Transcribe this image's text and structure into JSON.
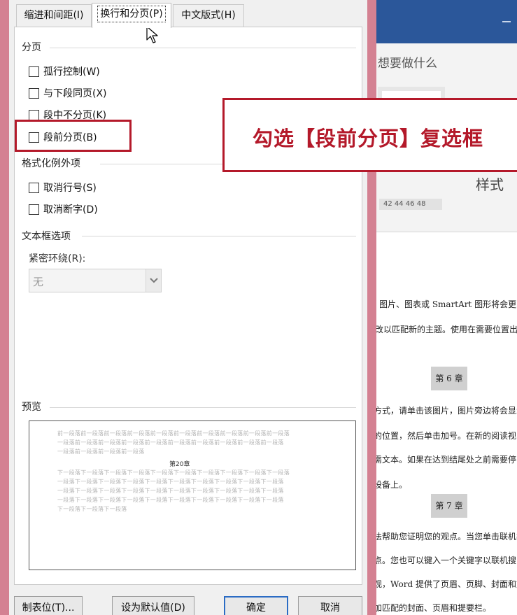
{
  "dialog": {
    "tabs": [
      {
        "label": "缩进和间距(I)"
      },
      {
        "label": "换行和分页(P)",
        "active": true
      },
      {
        "label": "中文版式(H)"
      }
    ],
    "pagination": {
      "title": "分页",
      "widow_control": "孤行控制(W)",
      "keep_with_next": "与下段同页(X)",
      "keep_lines_together": "段中不分页(K)",
      "page_break_before": "段前分页(B)"
    },
    "exceptions": {
      "title": "格式化例外项",
      "suppress_line_numbers": "取消行号(S)",
      "dont_hyphenate": "取消断字(D)"
    },
    "textbox": {
      "title": "文本框选项",
      "wrap_label": "紧密环绕(R):",
      "wrap_value": "无"
    },
    "preview": {
      "title": "预览",
      "prev_lines": [
        "前一段落前一段落前一段落前一段落前一段落前一段落前一段落前一段落前一段落前一段落",
        "一段落前一段落前一段落前一段落前一段落前一段落前一段落前一段落前一段落前一段落",
        "一段落前一段落前一段落前一段落"
      ],
      "heading": "第20章",
      "next_lines": [
        "下一段落下一段落下一段落下一段落下一段落下一段落下一段落下一段落下一段落下一段落",
        "一段落下一段落下一段落下一段落下一段落下一段落下一段落下一段落下一段落下一段落",
        "一段落下一段落下一段落下一段落下一段落下一段落下一段落下一段落下一段落下一段落",
        "一段落下一段落下一段落下一段落下一段落下一段落下一段落下一段落下一段落下一段落",
        "下一段落下一段落下一段落"
      ]
    },
    "buttons": {
      "tabs": "制表位(T)...",
      "set_default": "设为默认值(D)",
      "ok": "确定",
      "cancel": "取消"
    }
  },
  "annotation": {
    "callout": "勾选【段前分页】复选框",
    "color": "#b4192a"
  },
  "word_background": {
    "tell_me": "想要做什么",
    "styles_label": "样式",
    "ruler": "42 44 46 48",
    "doc_lines": [
      "图片、图表或 SmartArt 图形将会更改",
      "改以匹配新的主题。使用在需要位置出",
      "方式，请单击该图片，图片旁边将会显示",
      "的位置，然后单击加号。在新的阅读视图",
      "需文本。如果在达到结尾处之前需要停",
      "设备上。",
      "法帮助您证明您的观点。当您单击联机视",
      "点。您也可以键入一个关键字以联机搜",
      "观，Word 提供了页眉、页脚、封面和文",
      "加匹配的封面、页眉和提要栏。"
    ],
    "chapter_6": "第 6 章",
    "chapter_7": "第 7 章",
    "title_bar_color": "#2b579a"
  }
}
